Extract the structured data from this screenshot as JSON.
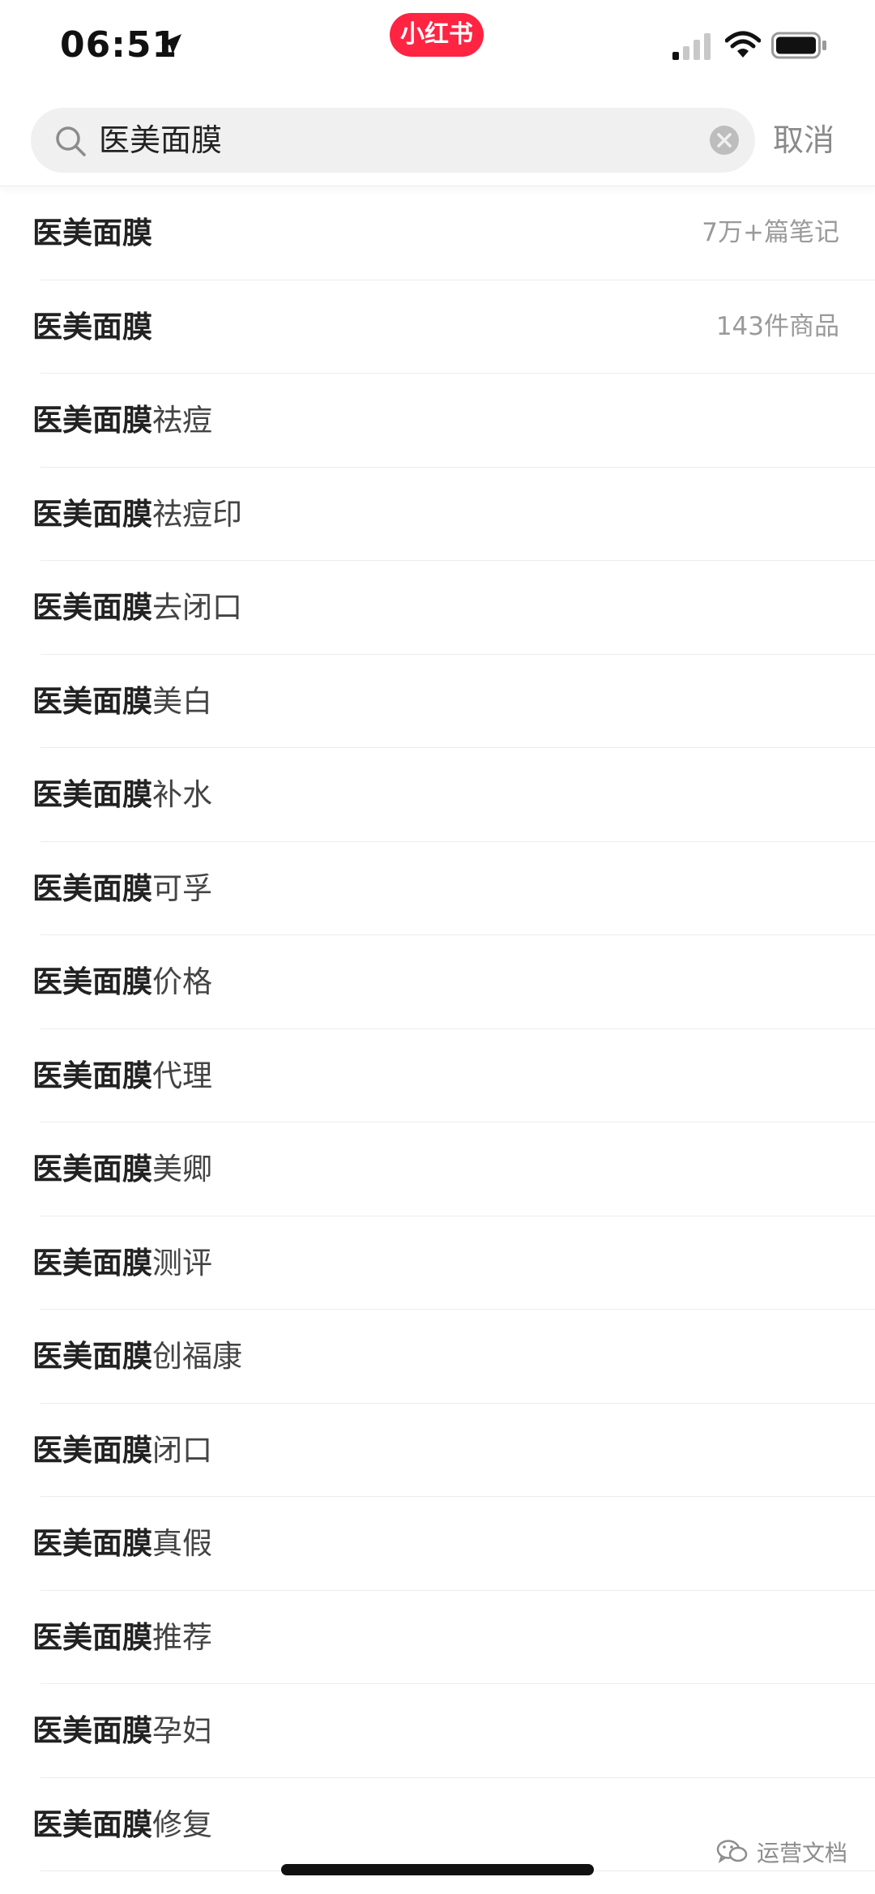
{
  "status_bar": {
    "time": "06:51",
    "app_badge": "小红书",
    "icons": [
      "location-icon",
      "signal-icon",
      "wifi-icon",
      "battery-icon"
    ]
  },
  "search": {
    "value": "医美面膜",
    "cancel_label": "取消",
    "icons": [
      "search-icon",
      "clear-icon"
    ]
  },
  "suggestions": [
    {
      "keyword": "医美面膜",
      "suffix": "",
      "meta": "7万+篇笔记"
    },
    {
      "keyword": "医美面膜",
      "suffix": "",
      "meta": "143件商品"
    },
    {
      "keyword": "医美面膜",
      "suffix": "祛痘",
      "meta": ""
    },
    {
      "keyword": "医美面膜",
      "suffix": "祛痘印",
      "meta": ""
    },
    {
      "keyword": "医美面膜",
      "suffix": "去闭口",
      "meta": ""
    },
    {
      "keyword": "医美面膜",
      "suffix": "美白",
      "meta": ""
    },
    {
      "keyword": "医美面膜",
      "suffix": "补水",
      "meta": ""
    },
    {
      "keyword": "医美面膜",
      "suffix": "可孚",
      "meta": ""
    },
    {
      "keyword": "医美面膜",
      "suffix": "价格",
      "meta": ""
    },
    {
      "keyword": "医美面膜",
      "suffix": "代理",
      "meta": ""
    },
    {
      "keyword": "医美面膜",
      "suffix": "美卿",
      "meta": ""
    },
    {
      "keyword": "医美面膜",
      "suffix": "测评",
      "meta": ""
    },
    {
      "keyword": "医美面膜",
      "suffix": "创福康",
      "meta": ""
    },
    {
      "keyword": "医美面膜",
      "suffix": "闭口",
      "meta": ""
    },
    {
      "keyword": "医美面膜",
      "suffix": "真假",
      "meta": ""
    },
    {
      "keyword": "医美面膜",
      "suffix": "推荐",
      "meta": ""
    },
    {
      "keyword": "医美面膜",
      "suffix": "孕妇",
      "meta": ""
    },
    {
      "keyword": "医美面膜",
      "suffix": "修复",
      "meta": ""
    }
  ],
  "watermark": {
    "text": "运营文档",
    "icon": "wechat-icon"
  },
  "colors": {
    "brand": "#ff2442",
    "meta_text": "#9a9a9a",
    "cancel_text": "#8a8a8a",
    "search_bg": "#f0f0f0"
  }
}
